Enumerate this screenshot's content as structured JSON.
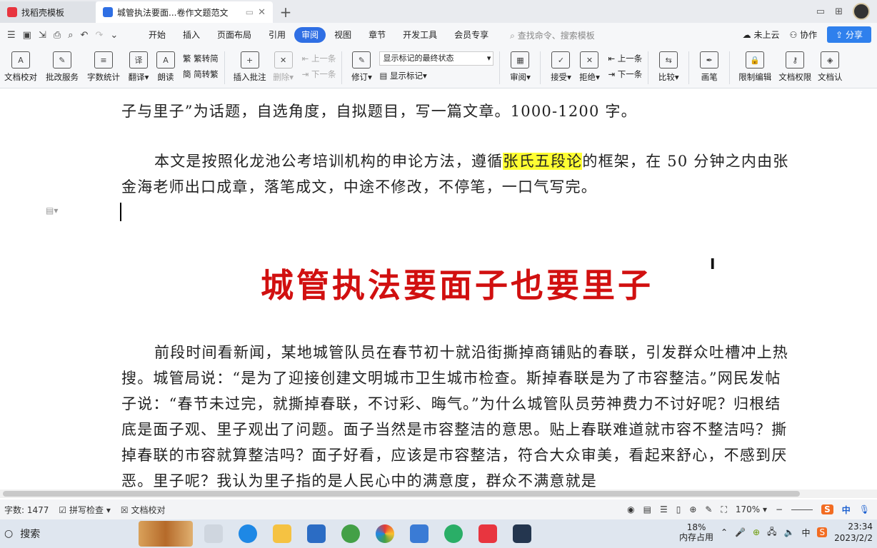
{
  "tabs": [
    {
      "label": "找稻壳模板"
    },
    {
      "label": "城管执法要面...卷作文题范文"
    }
  ],
  "menu": {
    "items": [
      "开始",
      "插入",
      "页面布局",
      "引用",
      "审阅",
      "视图",
      "章节",
      "开发工具",
      "会员专享"
    ],
    "active": "审阅",
    "search_placeholder": "查找命令、搜索模板",
    "cloud": "未上云",
    "collab": "协作",
    "share": "分享"
  },
  "ribbon": {
    "doc_proof": "文档校对",
    "batch_service": "批改服务",
    "word_count": "字数统计",
    "translate": "翻译",
    "read_aloud": "朗读",
    "to_traditional": "繁转简",
    "to_simplified": "简转繁",
    "insert_comment": "插入批注",
    "delete": "删除",
    "prev": "上一条",
    "next": "下一条",
    "revise": "修订",
    "markup_state": "显示标记的最终状态",
    "show_markup": "显示标记",
    "review": "审阅",
    "accept": "接受",
    "reject": "拒绝",
    "prev2": "上一条",
    "next2": "下一条",
    "compare": "比较",
    "pen": "画笔",
    "restrict_edit": "限制编辑",
    "doc_permission": "文档权限",
    "doc_cert": "文档认"
  },
  "document": {
    "line_top": "子与里子”为话题，自选角度，自拟题目，写一篇文章。1000-1200 字。",
    "intro_before": "本文是按照化龙池公考培训机构的申论方法，遵循",
    "intro_highlight": "张氏五段论",
    "intro_after": "的框架，在 50 分钟之内由张金海老师出口成章，落笔成文，中途不修改，不停笔，一口气写完。",
    "title": "城管执法要面子也要里子",
    "body": "前段时间看新闻，某地城管队员在春节初十就沿街撕掉商铺贴的春联，引发群众吐槽冲上热搜。城管局说：“是为了迎接创建文明城市卫生城市检查。斯掉春联是为了市容整洁。”网民发帖子说：“春节未过完，就撕掉春联，不讨彩、晦气。”为什么城管队员劳神费力不讨好呢？归根结底是面子观、里子观出了问题。面子当然是市容整洁的意思。贴上春联难道就市容不整洁吗？撕掉春联的市容就算整洁吗？面子好看，应该是市容整洁，符合大众审美，看起来舒心，不感到厌恶。里子呢？我认为里子指的是人民心中的满意度，群众不满意就是"
  },
  "status": {
    "word_count": "字数: 1477",
    "spell_check": "拼写检查",
    "doc_proof": "文档校对",
    "zoom": "170%"
  },
  "taskbar": {
    "search": "搜索",
    "mem_percent": "18%",
    "mem_label": "内存占用",
    "ime": "中",
    "time": "23:34",
    "date": "2023/2/2"
  }
}
